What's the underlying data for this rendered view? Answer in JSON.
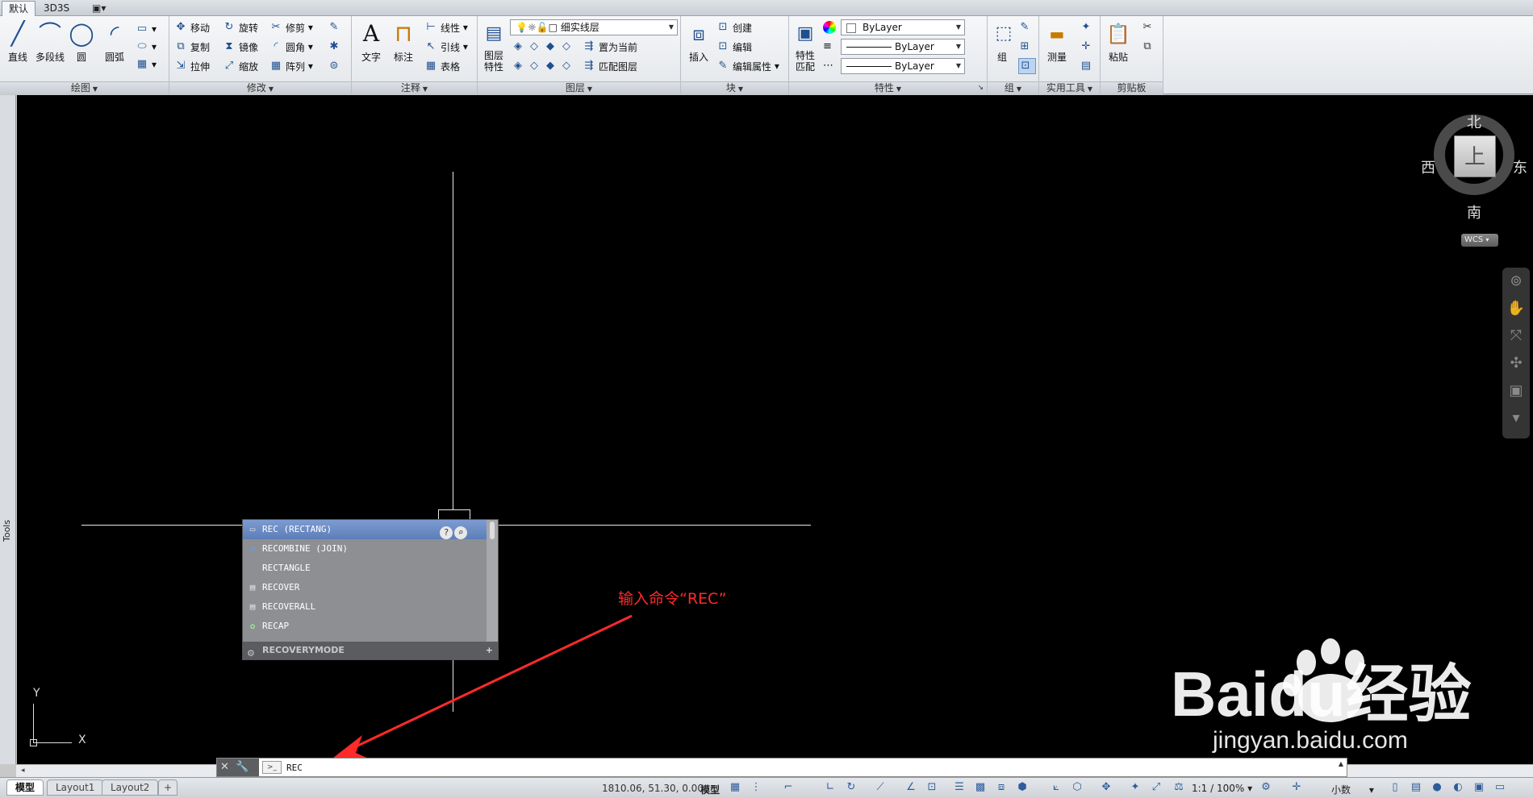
{
  "ribbon_tabs": [
    "默认",
    "3D3S",
    "▣▾"
  ],
  "panels": {
    "draw": {
      "title": "绘图",
      "line": "直线",
      "polyline": "多段线",
      "circle": "圆",
      "arc": "圆弧"
    },
    "modify": {
      "title": "修改",
      "move": "移动",
      "rotate": "旋转",
      "trim": "修剪",
      "copy": "复制",
      "mirror": "镜像",
      "fillet": "圆角",
      "stretch": "拉伸",
      "scale": "缩放",
      "array": "阵列"
    },
    "annotation": {
      "title": "注释",
      "text": "文字",
      "dimension": "标注",
      "linear": "线性",
      "leader": "引线",
      "table": "表格"
    },
    "layers": {
      "title": "图层",
      "layer_props": "图层\n特性",
      "layer_combo": "细实线层",
      "make_current": "置为当前",
      "match_layer": "匹配图层"
    },
    "block": {
      "title": "块",
      "insert": "插入",
      "create": "创建",
      "edit": "编辑",
      "edit_attr": "编辑属性"
    },
    "properties": {
      "title": "特性",
      "match": "特性\n匹配",
      "color": "ByLayer",
      "linetype": "ByLayer",
      "lineweight": "ByLayer"
    },
    "groups": {
      "title": "组",
      "group": "组"
    },
    "utilities": {
      "title": "实用工具",
      "measure": "测量"
    },
    "clipboard": {
      "title": "剪贴板",
      "paste": "粘贴"
    }
  },
  "side_palette": "Tools",
  "viewcube": {
    "north": "北",
    "south": "南",
    "east": "东",
    "west": "西",
    "face": "上",
    "wcs": "WCS"
  },
  "ucs": {
    "x": "X",
    "y": "Y"
  },
  "annotation_note": "输入命令“REC”",
  "autocomplete": {
    "items": [
      {
        "label": "REC (RECTANG)",
        "icon": "rectangle-icon",
        "selected": true
      },
      {
        "label": "RECOMBINE (JOIN)",
        "icon": "join-icon",
        "selected": false
      },
      {
        "label": "RECTANGLE",
        "icon": "",
        "selected": false
      },
      {
        "label": "RECOVER",
        "icon": "recover-icon",
        "selected": false
      },
      {
        "label": "RECOVERALL",
        "icon": "recover-icon",
        "selected": false
      },
      {
        "label": "RECAP",
        "icon": "recap-icon",
        "selected": false
      }
    ],
    "footer": "RECOVERYMODE"
  },
  "command_line": {
    "value": "REC"
  },
  "layout_tabs": [
    "模型",
    "Layout1",
    "Layout2",
    "+"
  ],
  "status": {
    "coords": "1810.06, 51.30, 0.00",
    "model": "模型",
    "scale": "1:1 / 100%",
    "units": "小数"
  },
  "watermark": {
    "brand": "Baidu经验",
    "url": "jingyan.baidu.com"
  }
}
